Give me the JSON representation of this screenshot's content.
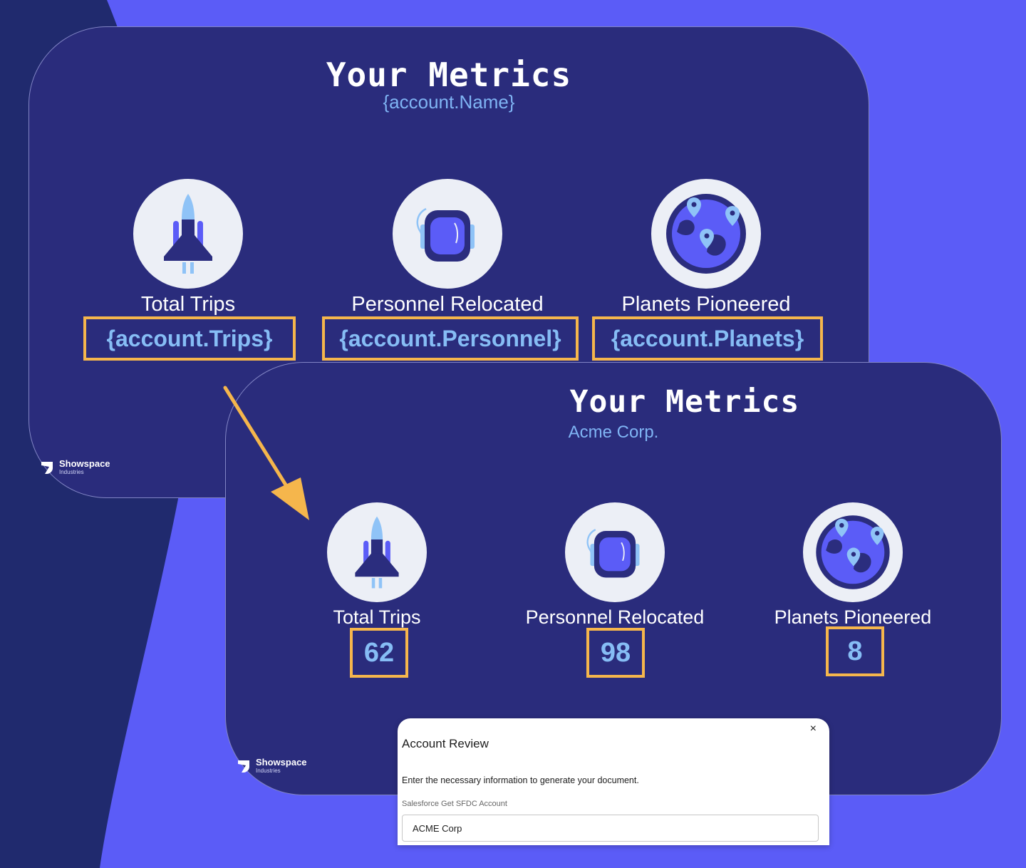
{
  "colors": {
    "background": "#5b5cf7",
    "dark_panel": "#202a6e",
    "card": "#2a2c7c",
    "highlight": "#f5b64c",
    "value_text": "#86bdf5",
    "subtitle_text": "#7fb4f4"
  },
  "template_card": {
    "title": "Your Metrics",
    "subtitle": "{account.Name}",
    "metrics": [
      {
        "icon": "rocket-icon",
        "label": "Total Trips",
        "value": "{account.Trips}"
      },
      {
        "icon": "astronaut-helmet-icon",
        "label": "Personnel Relocated",
        "value": "{account.Personnel}"
      },
      {
        "icon": "globe-pins-icon",
        "label": "Planets Pioneered",
        "value": "{account.Planets}"
      }
    ],
    "brand": {
      "name": "Showspace",
      "sub": "Industries"
    }
  },
  "rendered_card": {
    "title": "Your Metrics",
    "subtitle": "Acme Corp.",
    "metrics": [
      {
        "icon": "rocket-icon",
        "label": "Total Trips",
        "value": "62"
      },
      {
        "icon": "astronaut-helmet-icon",
        "label": "Personnel Relocated",
        "value": "98"
      },
      {
        "icon": "globe-pins-icon",
        "label": "Planets Pioneered",
        "value": "8"
      }
    ],
    "brand": {
      "name": "Showspace",
      "sub": "Industries"
    }
  },
  "modal": {
    "title": "Account Review",
    "close": "×",
    "description": "Enter the necessary information to generate your document.",
    "field_label": "Salesforce Get SFDC Account",
    "field_value": "ACME Corp"
  }
}
